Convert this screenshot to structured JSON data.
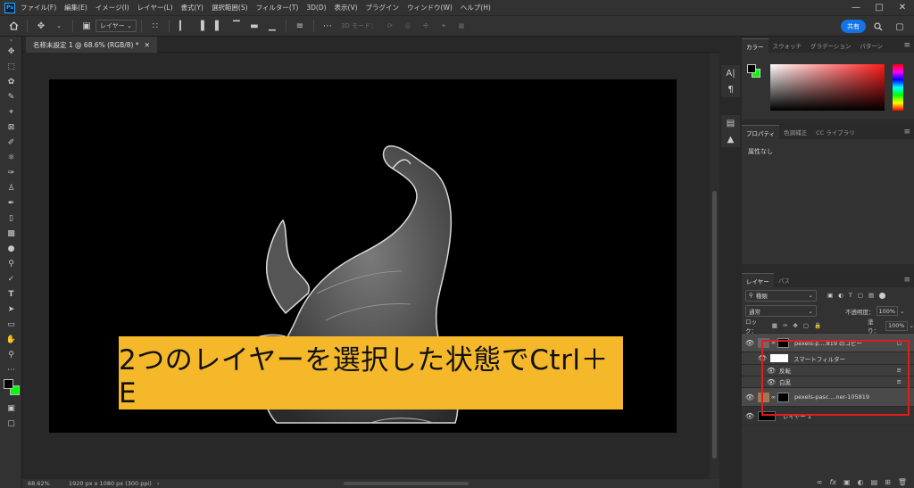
{
  "menubar": {
    "items": [
      "ファイル(F)",
      "編集(E)",
      "イメージ(I)",
      "レイヤー(L)",
      "書式(Y)",
      "選択範囲(S)",
      "フィルター(T)",
      "3D(D)",
      "表示(V)",
      "プラグイン",
      "ウィンドウ(W)",
      "ヘルプ(H)"
    ]
  },
  "optionsbar": {
    "target_select": "レイヤー",
    "mode_3d": "3D モード：",
    "share_label": "共有"
  },
  "document": {
    "tab_title": "名称未設定 1 @ 68.6% (RGB/8) *",
    "caption": "2つのレイヤーを選択した状態でCtrl＋E",
    "zoom": "68.62%",
    "size_info": "1920 px x 1080 px (300 ppi)"
  },
  "color_panel": {
    "tabs": [
      "カラー",
      "スウォッチ",
      "グラデーション",
      "パターン"
    ],
    "foreground": "#000000",
    "background": "#00ff00"
  },
  "properties_panel": {
    "tabs": [
      "プロパティ",
      "色調補正",
      "CC ライブラリ"
    ],
    "content": "属性なし"
  },
  "layers_panel": {
    "tabs": [
      "レイヤー",
      "パス"
    ],
    "filter_kind": "種類",
    "blend_mode": "通常",
    "opacity_label": "不透明度：",
    "opacity": "100%",
    "lock_label": "ロック：",
    "fill_label": "塗り：",
    "fill": "100%",
    "layers": [
      {
        "name": "pexels-p....819 のコピー"
      },
      {
        "name": "スマートフィルター"
      },
      {
        "name": "反転"
      },
      {
        "name": "白黒"
      },
      {
        "name": "pexels-pasc....ner-105819"
      },
      {
        "name": "レイヤー 1"
      }
    ]
  }
}
